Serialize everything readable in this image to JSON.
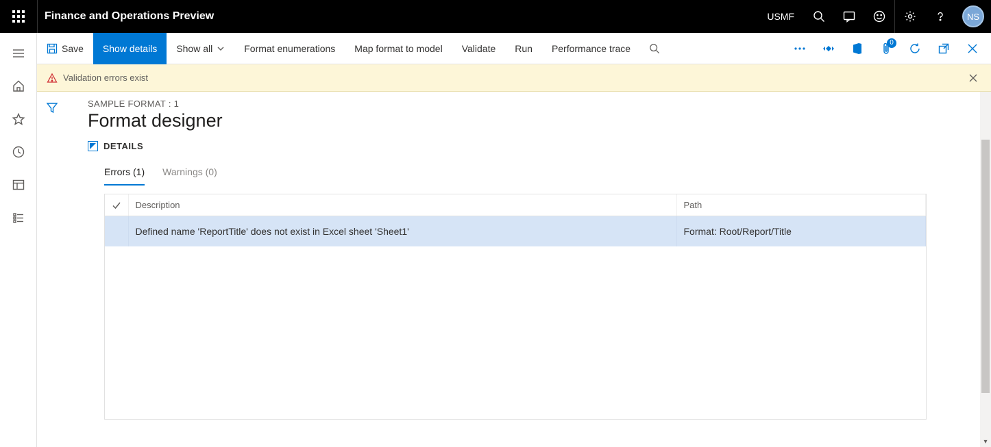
{
  "header": {
    "app_title": "Finance and Operations Preview",
    "company": "USMF",
    "avatar_initials": "NS"
  },
  "commandbar": {
    "save_label": "Save",
    "show_details_label": "Show details",
    "show_all_label": "Show all",
    "format_enum_label": "Format enumerations",
    "map_format_label": "Map format to model",
    "validate_label": "Validate",
    "run_label": "Run",
    "perf_trace_label": "Performance trace",
    "badge_count": "0"
  },
  "notification": {
    "message": "Validation errors exist"
  },
  "page": {
    "crumb": "SAMPLE FORMAT : 1",
    "title": "Format designer",
    "details_label": "DETAILS"
  },
  "tabs": {
    "errors_label": "Errors (1)",
    "warnings_label": "Warnings (0)"
  },
  "table": {
    "columns": {
      "description": "Description",
      "path": "Path"
    },
    "rows": [
      {
        "description": "Defined name 'ReportTitle' does not exist in Excel sheet 'Sheet1'",
        "path": "Format: Root/Report/Title"
      }
    ]
  }
}
